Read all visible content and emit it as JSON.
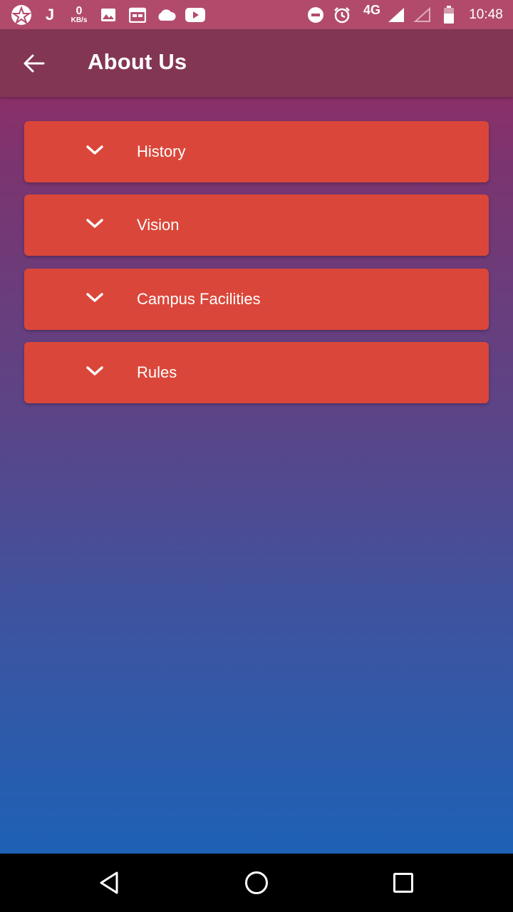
{
  "status_bar": {
    "net_speed_value": "0",
    "net_speed_unit": "KB/s",
    "network_type": "4G",
    "time": "10:48",
    "icons": [
      "app-logo-icon",
      "j-icon",
      "gallery-icon",
      "calendar-icon",
      "cloud-icon",
      "youtube-icon",
      "dnd-icon",
      "alarm-icon",
      "signal-icon",
      "signal-empty-icon",
      "battery-icon"
    ]
  },
  "app_bar": {
    "title": "About Us",
    "back_icon": "arrow-left-icon"
  },
  "sections": [
    {
      "label": "History",
      "icon": "chevron-down-icon"
    },
    {
      "label": "Vision",
      "icon": "chevron-down-icon"
    },
    {
      "label": "Campus Facilities",
      "icon": "chevron-down-icon"
    },
    {
      "label": "Rules",
      "icon": "chevron-down-icon"
    }
  ],
  "nav_bar": {
    "buttons": [
      "back-triangle-icon",
      "home-circle-icon",
      "recents-square-icon"
    ]
  },
  "colors": {
    "status_bar": "#b24b6b",
    "app_bar": "#833654",
    "card": "#da473a",
    "gradient_top": "#a2295f",
    "gradient_bottom": "#1e61b5"
  }
}
